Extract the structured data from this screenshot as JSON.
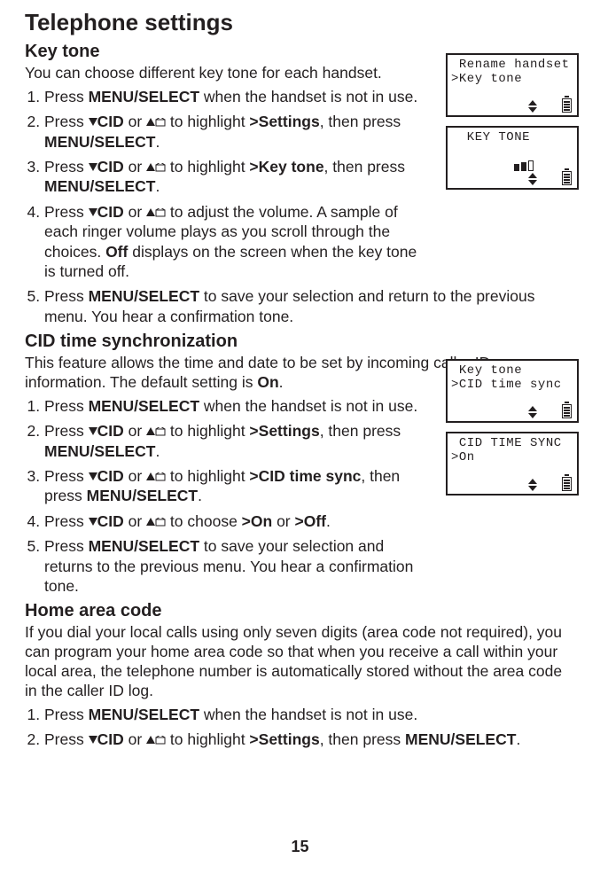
{
  "title": "Telephone settings",
  "pageNumber": "15",
  "sections": {
    "keyTone": {
      "heading": "Key tone",
      "lead": "You can choose different key tone for each handset.",
      "steps": {
        "s1": {
          "a": "Press ",
          "b": "MENU/",
          "c": "SELECT",
          "d": " when the handset is not in use."
        },
        "s2": {
          "a": "Press ",
          "b": "CID",
          "c": " or ",
          "d": " to highlight ",
          "e": ">Settings",
          "f": ", then press ",
          "g": "MENU",
          "h": "/SELECT",
          "i": "."
        },
        "s3": {
          "a": "Press ",
          "b": "CID",
          "c": " or ",
          "d": " to highlight ",
          "e": ">Key tone",
          "f": ", then press ",
          "g": "MENU",
          "h": "/SELECT",
          "i": "."
        },
        "s4": {
          "a": "Press ",
          "b": "CID",
          "c": " or ",
          "d": " to adjust the volume. A sample of each ringer volume plays as you scroll through the choices. ",
          "e": "Off",
          "f": " displays on the screen when the key tone is turned off."
        },
        "s5": {
          "a": "Press ",
          "b": "MENU",
          "c": "/SELECT",
          "d": " to save your selection and return to the previous menu. You hear a confirmation tone."
        }
      }
    },
    "cidSync": {
      "heading": "CID time synchronization",
      "lead1": "This feature allows the time and date to be set by incoming caller ID information. The default setting is ",
      "leadBold": "On",
      "lead2": ".",
      "steps": {
        "s1": {
          "a": "Press ",
          "b": "MENU/",
          "c": "SELECT",
          "d": " when the handset is not in use."
        },
        "s2": {
          "a": "Press ",
          "b": "CID",
          "c": " or ",
          "d": " to highlight ",
          "e": ">Settings",
          "f": ", then press ",
          "g": "MENU",
          "h": "/SELECT",
          "i": "."
        },
        "s3": {
          "a": "Press ",
          "b": "CID",
          "c": " or ",
          "d": " to highlight ",
          "e": ">CID time sync",
          "f": ", then press ",
          "g": "MENU",
          "h": "/SELECT",
          "i": "."
        },
        "s4": {
          "a": "Press ",
          "b": "CID",
          "c": " or ",
          "d": " to choose ",
          "e": ">On",
          "f": " or ",
          "g": ">Off",
          "h": "."
        },
        "s5": {
          "a": "Press ",
          "b": "MENU",
          "c": "/SELECT",
          "d": " to save your selection and returns to the previous menu. You hear a confirmation tone."
        }
      }
    },
    "homeArea": {
      "heading": "Home area code",
      "lead": "If you dial your local calls using only seven digits (area code not required), you can program your home area code so that when you receive a call within your local area, the telephone number is automatically stored without the area code in the caller ID log.",
      "steps": {
        "s1": {
          "a": "Press ",
          "b": "MENU/",
          "c": "SELECT",
          "d": " when the handset is not in use."
        },
        "s2": {
          "a": "Press ",
          "b": "CID",
          "c": " or ",
          "d": " to highlight ",
          "e": ">Settings",
          "f": ", then press ",
          "g": "MENU",
          "h": "/SELECT",
          "i": "."
        }
      }
    }
  },
  "screens": {
    "s1": {
      "line1": " Rename handset",
      "line2": ">Key tone"
    },
    "s2": {
      "line1": "  KEY TONE",
      "line2": ""
    },
    "s3": {
      "line1": " Key tone",
      "line2": ">CID time sync"
    },
    "s4": {
      "line1": " CID TIME SYNC",
      "line2": ">On"
    }
  }
}
